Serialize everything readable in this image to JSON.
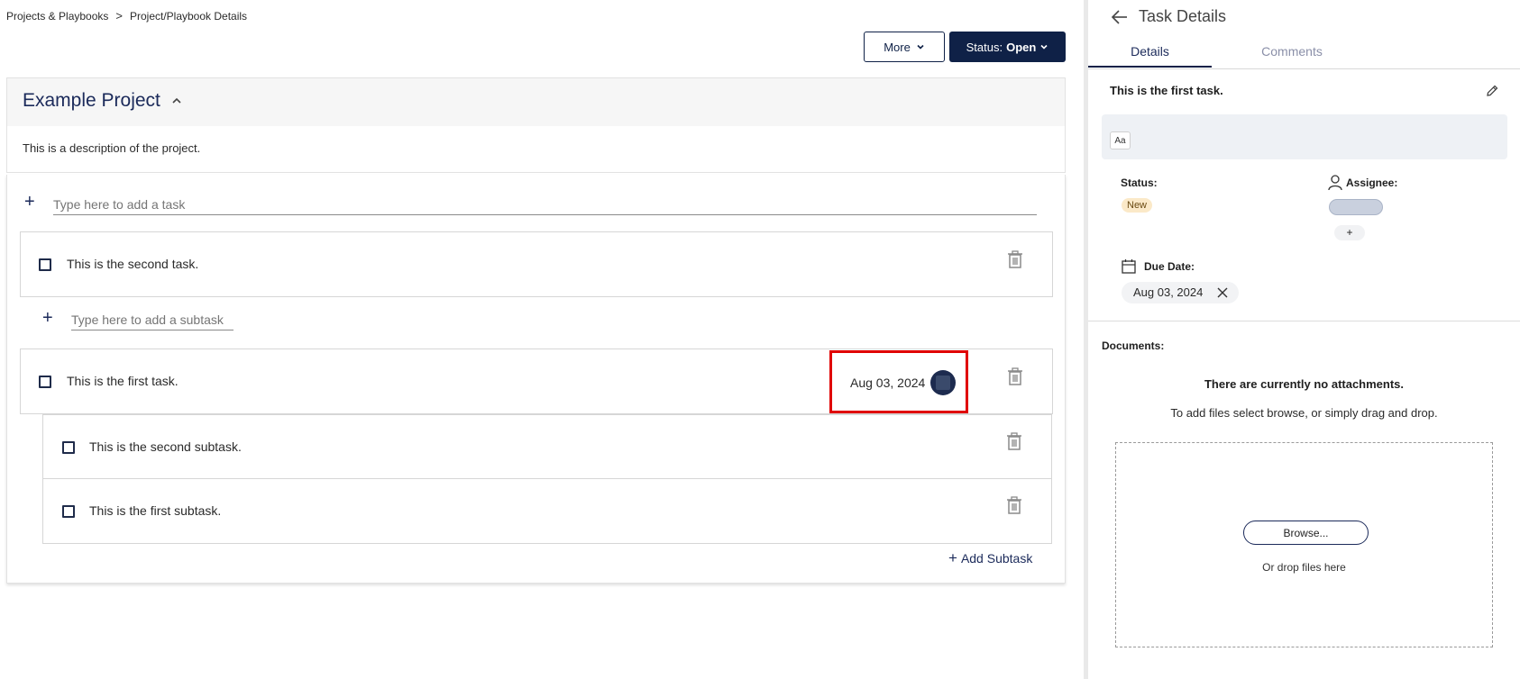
{
  "breadcrumb": {
    "items": [
      "Projects & Playbooks",
      "Project/Playbook Details"
    ],
    "separator": ">"
  },
  "header": {
    "more_label": "More",
    "status_prefix": "Status:",
    "status_value": "Open"
  },
  "project": {
    "title": "Example Project",
    "description": "This is a description of the project."
  },
  "tasks_panel": {
    "add_task_placeholder": "Type here to add a task",
    "add_subtask_placeholder": "Type here to add a subtask",
    "add_subtask_link": "Add Subtask",
    "tasks": [
      {
        "label": "This is the second task."
      },
      {
        "label": "This is the first task.",
        "due_date": "Aug 03, 2024"
      }
    ],
    "subtasks": [
      {
        "label": "This is the second subtask."
      },
      {
        "label": "This is the first subtask."
      }
    ]
  },
  "task_details": {
    "title": "Task Details",
    "tabs": [
      {
        "label": "Details",
        "active": true
      },
      {
        "label": "Comments",
        "active": false
      }
    ],
    "task_name": "This is the first task.",
    "editor_button": "Aa",
    "status_label": "Status:",
    "status_value": "New",
    "assignee_label": "Assignee:",
    "assignee_add": "+",
    "due_date_label": "Due Date:",
    "due_date_value": "Aug 03, 2024",
    "documents_label": "Documents:",
    "no_attachments": "There are currently no attachments.",
    "add_hint": "To add files select browse, or simply drag and drop.",
    "browse_label": "Browse...",
    "drop_hint": "Or drop files here"
  },
  "colors": {
    "navy": "#0f2147",
    "highlight": "#e00000",
    "badge_new_bg": "#fbe9c8"
  }
}
